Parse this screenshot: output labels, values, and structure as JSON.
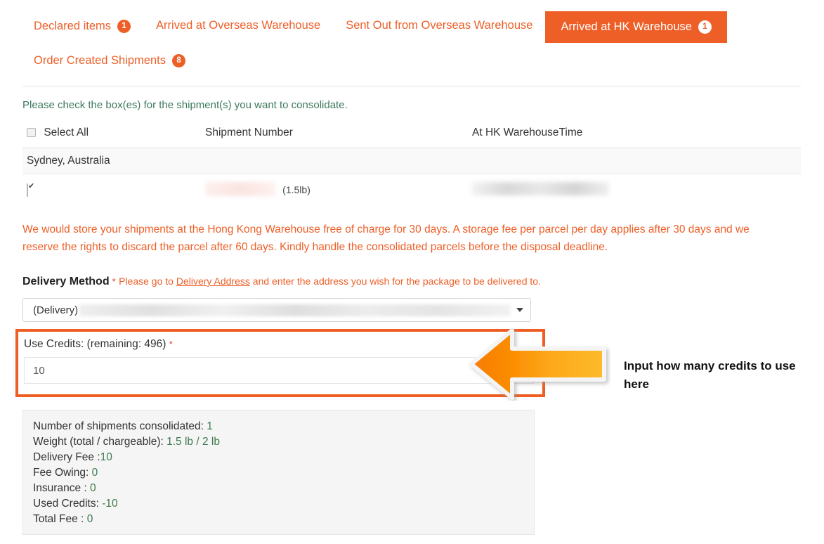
{
  "colors": {
    "brand_orange": "#ee5f28",
    "highlight_orange": "#ef5d22",
    "green_text": "#3d7a5d",
    "value_green": "#3d7a4e",
    "required_red": "#e03b2f"
  },
  "tabs": [
    {
      "label": "Declared items",
      "badge": "1",
      "active": false
    },
    {
      "label": "Arrived at Overseas Warehouse",
      "badge": "",
      "active": false
    },
    {
      "label": "Sent Out from Overseas Warehouse",
      "badge": "",
      "active": false
    },
    {
      "label": "Arrived at HK Warehouse",
      "badge": "1",
      "active": true
    },
    {
      "label": "Order Created Shipments",
      "badge": "8",
      "active": false
    }
  ],
  "instruction": "Please check the box(es) for the shipment(s) you want to consolidate.",
  "table": {
    "headers": {
      "select_all": "Select All",
      "shipment_number": "Shipment Number",
      "at_hk_warehouse_time": "At HK WarehouseTime"
    },
    "group_label": "Sydney, Australia",
    "rows": [
      {
        "checked": true,
        "shipment_number": "",
        "weight": "(1.5lb)",
        "arrival_time": ""
      }
    ]
  },
  "notice": "We would store your shipments at the Hong Kong Warehouse free of charge for 30 days. A storage fee per parcel per day applies after 30 days and we reserve the rights to discard the parcel after 60 days. Kindly handle the consolidated parcels before the disposal deadline.",
  "delivery": {
    "label": "Delivery Method",
    "required_mark": "*",
    "hint_before": "Please go to",
    "hint_link": "Delivery Address",
    "hint_after": "and enter the address you wish for the package to be delivered to.",
    "selected_prefix": "(Delivery)"
  },
  "credits": {
    "label": "Use Credits: (remaining: 496)",
    "required_mark": "*",
    "value": "10"
  },
  "annotation": {
    "text": "Input how many credits to use here",
    "arrow_icon": "left-arrow-icon"
  },
  "summary": [
    {
      "label": "Number of shipments consolidated:",
      "value": "1"
    },
    {
      "label": "Weight (total / chargeable):",
      "value": "1.5 lb / 2 lb"
    },
    {
      "label": "Delivery Fee :",
      "value": "10"
    },
    {
      "label": "Fee Owing:",
      "value": "0"
    },
    {
      "label": "Insurance :",
      "value": "0"
    },
    {
      "label": "Used Credits:",
      "value": "-10"
    },
    {
      "label": "Total Fee :",
      "value": "0"
    }
  ]
}
